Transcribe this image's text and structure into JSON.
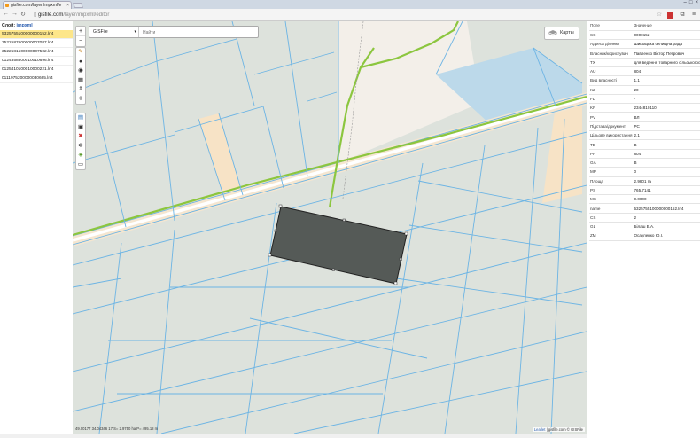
{
  "browser": {
    "tab_title": "gisfile.com/layer/impxml/e",
    "url_host": "gisfile.com",
    "url_path": "/layer/impxml/editor"
  },
  "layer_panel": {
    "label": "Слой:",
    "layer_name": "impxml",
    "files": [
      "5325755100000000152.ln4",
      "3522587600000007087.ln4",
      "3522581500000007502.ln4",
      "0124358800010010696.ln4",
      "0125410100010000221.ln4",
      "0111975200000030665.ln4"
    ],
    "active_index": 0
  },
  "map": {
    "zoom_in": "+",
    "zoom_out": "−",
    "layer_select": "GISFile",
    "search_placeholder": "Найти",
    "maps_button": "Карты",
    "status": "49.00177 34.04346 17 S= 2.9750 ha P= 495.18 m",
    "attribution_prefix": "Leaflet",
    "attribution_suffix": "| gisfile.com © GISFile"
  },
  "attributes": {
    "header_field": "Поле",
    "header_value": "Значение",
    "rows": [
      [
        "SC",
        "0000152"
      ],
      [
        "Адреса ділянки",
        "Шишацька селищна рада"
      ],
      [
        "Власник/користувач",
        "Павленко Віктор Петрович"
      ],
      [
        "TX",
        "для ведення товарного сільськогосподарського виробництва"
      ],
      [
        "AU",
        "804"
      ],
      [
        "Вид власності",
        "1.1"
      ],
      [
        "KZ",
        "20"
      ],
      [
        "FL",
        "-"
      ],
      [
        "KF",
        "2344810110"
      ],
      [
        "PV",
        "ВЛ"
      ],
      [
        "Підстава/документ",
        "РС"
      ],
      [
        "Цільове використання",
        "2.1"
      ],
      [
        "TD",
        "В"
      ],
      [
        "PF",
        "804"
      ],
      [
        "GA",
        "В"
      ],
      [
        "MP",
        "0"
      ],
      [
        "Площа",
        "2.9801 га"
      ],
      [
        "PS",
        "765.7141"
      ],
      [
        "MS",
        "0.0000"
      ],
      [
        "name",
        "5325755100000000152.ln4"
      ],
      [
        "CS",
        "2"
      ],
      [
        "GL",
        "Білаш В.А."
      ],
      [
        "ZM",
        "Осауленко Ю.І."
      ]
    ]
  },
  "colors": {
    "map_bg": "#dde2dc",
    "parcel_line": "#6cb4e4",
    "road_green": "#8cc63f",
    "selected_parcel": "#555a57",
    "highlight_row": "#fde68a"
  }
}
